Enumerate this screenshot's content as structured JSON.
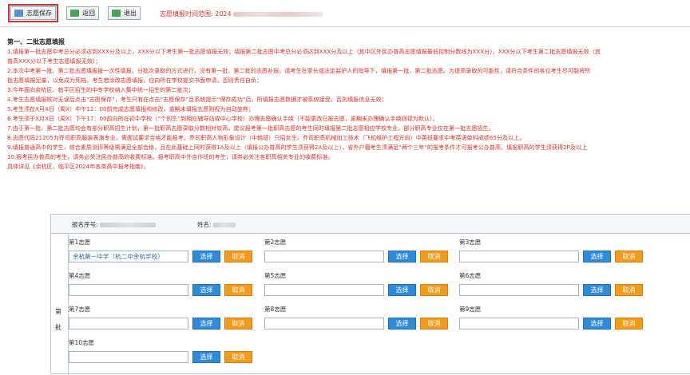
{
  "toolbar": {
    "save_label": "志愿保存",
    "back_label": "返回",
    "exit_label": "退出",
    "time_label": "志愿填报时间范围: 2024"
  },
  "notice": {
    "title": "第一、二批志愿填报",
    "lines": [
      "1.填报第一批志愿中考总分必须达到XXX分及以上，XXX分以下考生第一批志愿填报无效；填报第二批志愿中考总分必须达到XXX分及以上（其中区外民办普高志愿填报最低控制分数线为XXX分），XXX分以下考生第二批志愿填报无效（其",
      "普高XXX分以下考生志愿填报无效）；",
      "2.本次中考第一批、第二批志愿填报按一次性填报，分批次录取的方式进行，没有第一批、第二批的志愿补报，请考生在家长或法定监护人的指导下，填报第一批、第二批志愿。为提高录取的可能性，请符合条件的各位考生尽可能将所",
      "批志愿填报足量，以免成为死档。考生若涂改志愿填报，应向所在学校提交书面申请，否则责任自负；",
      "3.今年面向余杭区、临平区招生的中专学校纳入集中统一招生的第二批次；",
      "4.考生志愿填报核对无误后点击“志愿保存”，考生只有在点击“志愿保存”且系统提示“保存成功”后，所填报志愿数据才被系统接受，否则填报信息无效；",
      "5.考生须在X月X日（周X）中午12：00前完成志愿填报和修改，逾期未填报志愿则视为自动放弃；",
      "6.考生须于X月X日（周X）下午17：00前向所在初中学校（“个别生”到相应辅导站或中心学校）办理志愿确认手续（不能更改已报志愿，逾期未办理确认手续则视为默认）。",
      "7.由于第一批、第二批志愿均会有部分职高招生计划，第一批职高志愿录取分数相对较高，建议报考第一批职高志愿的考生同时填报第二批志愿相应学校专业。部分职高专业仅在第一批志愿招生。",
      "8.志愿代码21205为乔司职高服装表演专业，需面试要求合格才能报考。乔司职高人物形象设计（中韩班）只招女生。乔司职高机械加工技术（飞机维护工程方向）中英班要求中考英语单科成绩65分及以上。",
      "9.填报普通高中的学生，综合素质测评等级需满足全部合格，且在此基础上同时获得1A及以上（填报公办普高的学生须获得2A及以上），省外户籍考生须满足“两个三年”的报考条件才可报考公办普高。填报职高的学生须获得2P及以上",
      "10.报考民办普高的考生，请务必关注民办普高的收费标准。报考职高中外合作班的考生，请务必关注各职高相关专业的收费标准。"
    ],
    "footer": "具体详见《余杭区、临平区2024年各类高中报考指南》。"
  },
  "form": {
    "reg_label": "报名序号:",
    "name_label": "姓名:",
    "batch_label_1": "第",
    "batch_label_2": "批",
    "select_label": "选择",
    "cancel_label": "取消",
    "choices": [
      {
        "label": "第1志愿",
        "value": "余杭第一中学（杭二中余杭学校）"
      },
      {
        "label": "第2志愿",
        "value": ""
      },
      {
        "label": "第3志愿",
        "value": ""
      },
      {
        "label": "第4志愿",
        "value": ""
      },
      {
        "label": "第5志愿",
        "value": ""
      },
      {
        "label": "第6志愿",
        "value": ""
      },
      {
        "label": "第7志愿",
        "value": ""
      },
      {
        "label": "第8志愿",
        "value": ""
      },
      {
        "label": "第9志愿",
        "value": ""
      },
      {
        "label": "第10志愿",
        "value": ""
      }
    ]
  },
  "colors": {
    "notice_red": "#d9302b",
    "select_blue": "#2e8bd8",
    "cancel_orange": "#f29b1d",
    "highlight_box": "#d9302b"
  },
  "icons": {
    "save": "save-icon",
    "back": "back-icon",
    "exit": "exit-icon"
  }
}
